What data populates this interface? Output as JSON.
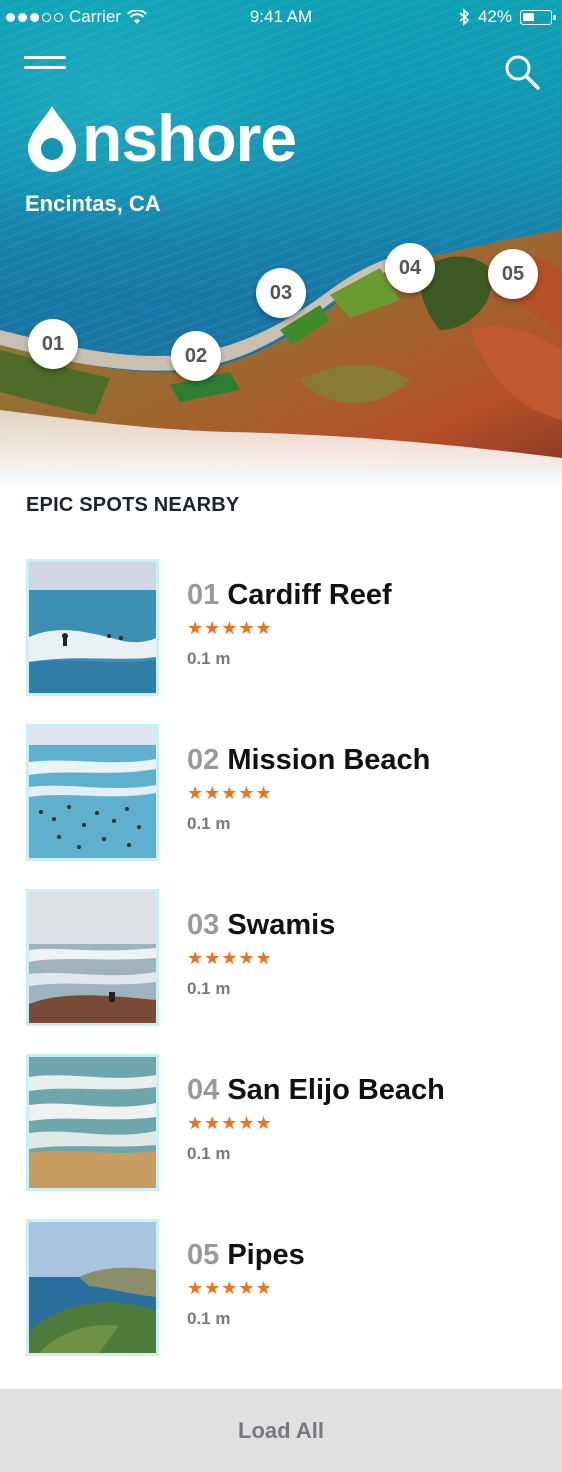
{
  "status_bar": {
    "carrier": "Carrier",
    "time": "9:41 AM",
    "battery": "42%"
  },
  "header": {
    "brand": "nshore",
    "brand_full": "Onshore",
    "location": "Encintas, CA"
  },
  "map": {
    "pins": [
      "01",
      "02",
      "03",
      "04",
      "05"
    ]
  },
  "section_title": "EPIC SPOTS NEARBY",
  "spots": [
    {
      "number": "01",
      "name": "Cardiff Reef",
      "stars": "★★★★★",
      "rating": 5,
      "distance": "0.1 m"
    },
    {
      "number": "02",
      "name": "Mission Beach",
      "stars": "★★★★★",
      "rating": 5,
      "distance": "0.1 m"
    },
    {
      "number": "03",
      "name": "Swamis",
      "stars": "★★★★★",
      "rating": 5,
      "distance": "0.1 m"
    },
    {
      "number": "04",
      "name": "San Elijo Beach",
      "stars": "★★★★★",
      "rating": 5,
      "distance": "0.1 m"
    },
    {
      "number": "05",
      "name": "Pipes",
      "stars": "★★★★★",
      "rating": 5,
      "distance": "0.1 m"
    }
  ],
  "load_all_label": "Load All",
  "colors": {
    "accent": "#f07118",
    "sea": "#138fb0",
    "thumb_border": "#c9f0f3",
    "footer_bg": "#dfe0e2"
  }
}
